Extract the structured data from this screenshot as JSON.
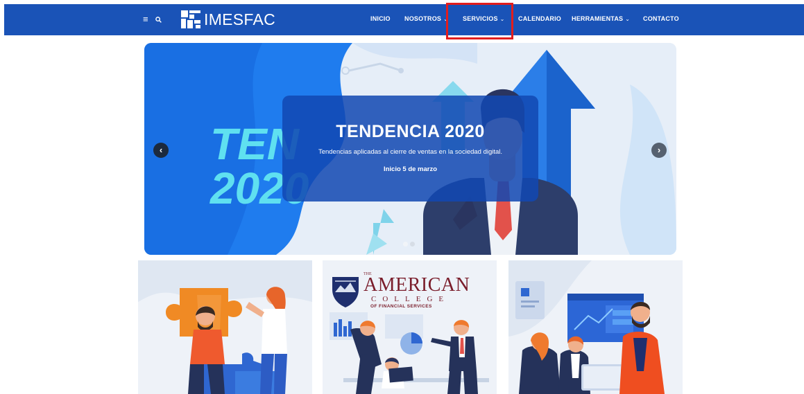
{
  "header": {
    "logo_text": "IMESFAC",
    "nav": [
      {
        "label": "INICIO",
        "has_dropdown": false
      },
      {
        "label": "NOSOTROS",
        "has_dropdown": true
      },
      {
        "label": "SERVICIOS",
        "has_dropdown": true,
        "highlighted": true
      },
      {
        "label": "CALENDARIO",
        "has_dropdown": false
      },
      {
        "label": "HERRAMIENTAS",
        "has_dropdown": true
      },
      {
        "label": "CONTACTO",
        "has_dropdown": false
      }
    ],
    "icons": [
      "menu-icon",
      "search-icon"
    ]
  },
  "hero": {
    "background_text_line1": "TEN",
    "background_text_line2": "2020",
    "title": "TENDENCIA 2020",
    "subtitle": "Tendencias aplicadas al cierre de ventas en la sociedad digital.",
    "date": "Inicio 5 de marzo",
    "slide_count": 2,
    "active_slide": 1
  },
  "cards": [
    {
      "illustration": "puzzle-teamwork"
    },
    {
      "logo": {
        "the": "THE",
        "american": "AMERICAN",
        "college": "COLLEGE",
        "financial": "OF FINANCIAL SERVICES"
      },
      "illustration": "business-presentation"
    },
    {
      "illustration": "team-meeting"
    }
  ],
  "colors": {
    "header_bg": "#1a53b7",
    "highlight": "#e31d1d",
    "hero_card": "#1248b2",
    "hero_blue": "#1e78e8"
  }
}
